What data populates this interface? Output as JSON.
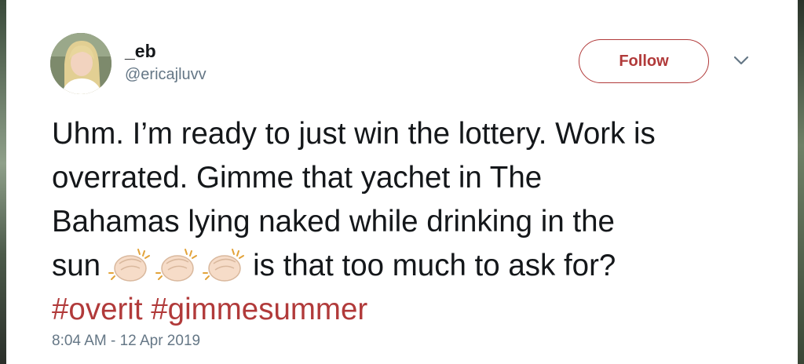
{
  "tweet": {
    "author": {
      "display_name": "_eb",
      "handle": "@ericajluvv"
    },
    "follow_label": "Follow",
    "text_lines": [
      "Uhm. I’m ready to just win the lottery. Work is",
      "overrated. Gimme that yachet in The",
      "Bahamas lying naked while drinking in the"
    ],
    "last_line_start": "sun",
    "clap_emoji": "👏🏻👏🏻👏🏻",
    "last_line_end": "is that too much to ask for?",
    "hashtags": [
      "#overit",
      "#gimmesummer"
    ],
    "timestamp": "8:04 AM - 12 Apr 2019"
  },
  "icons": {
    "avatar": "user-avatar-photo",
    "caret": "chevron-down-icon",
    "emoji": "clapping-hands-icon"
  },
  "colors": {
    "accent": "#b13a3a",
    "text": "#14171a",
    "secondary": "#657786"
  }
}
